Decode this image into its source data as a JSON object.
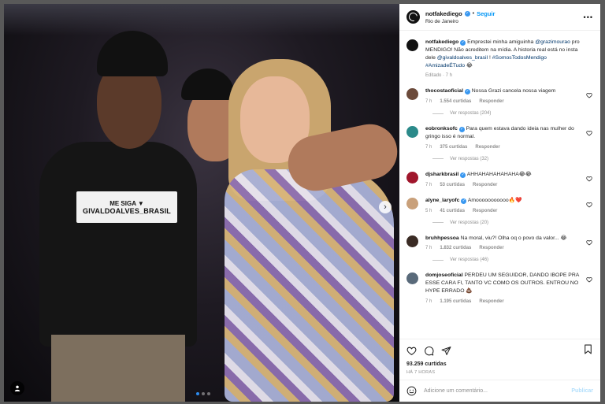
{
  "post": {
    "username": "notfakediego",
    "follow_label": "Seguir",
    "location": "Rio de Janeiro",
    "more_label": "•••"
  },
  "photo": {
    "shirt_line1": "ME SIGA ▼",
    "shirt_line2": "GIVALDOALVES_BRASIL",
    "next_arrow": "›"
  },
  "caption": {
    "username": "notfakediego",
    "text_a": "Emprestei minha amiguinha ",
    "mention1": "@grazimourao",
    "text_b": " pro MENDIGO! Não acreditem na mídia. A historia real está no insta dele ",
    "mention2": "@givaldoalves_brasil",
    "text_c": " ! ",
    "tags": "#SomosTodosMendigo #AmizadeÉTudo",
    "emoji": "😂",
    "edited": "Editado · 7 h"
  },
  "comments": [
    {
      "user": "thocostaoficial",
      "verified": true,
      "text": "Nossa Grazi cancela nossa viagem",
      "time": "7 h",
      "likes": "1.554 curtidas",
      "reply": "Responder",
      "replies": "Ver respostas (204)",
      "avatar_color": "#6b4a3a"
    },
    {
      "user": "eobronksofc",
      "verified": true,
      "text": "Para quem estava dando ideia nas mulher do gringo isso é normal.",
      "time": "7 h",
      "likes": "375 curtidas",
      "reply": "Responder",
      "replies": "Ver respostas (32)",
      "avatar_color": "#2b8a8a"
    },
    {
      "user": "djsharkbrasil",
      "verified": true,
      "text": "AHHAHAHAHAHAHA😂😂",
      "time": "7 h",
      "likes": "53 curtidas",
      "reply": "Responder",
      "replies": "",
      "avatar_color": "#a0162c"
    },
    {
      "user": "alyne_laryofc",
      "verified": true,
      "text": "Amooooooooooo🔥❤️",
      "time": "5 h",
      "likes": "41 curtidas",
      "reply": "Responder",
      "replies": "Ver respostas (20)",
      "avatar_color": "#c9a07a"
    },
    {
      "user": "bruhhpessoa",
      "verified": false,
      "text": "Na moral, viu?! Olha oq o povo da valor... 😂",
      "time": "7 h",
      "likes": "1.832 curtidas",
      "reply": "Responder",
      "replies": "Ver respostas (46)",
      "avatar_color": "#3a2b24"
    },
    {
      "user": "domjoseoficial",
      "verified": false,
      "text": "PERDEU UM SEGUIDOR, DANDO IBOPE PRA ESSE CARA FI, TANTO VC COMO OS OUTROS. ENTROU NO HYPE ERRADO 💩",
      "time": "7 h",
      "likes": "1.195 curtidas",
      "reply": "Responder",
      "replies": "",
      "avatar_color": "#596a7a"
    }
  ],
  "footer": {
    "likes": "93.259 curtidas",
    "time": "HÁ 7 HORAS",
    "comment_placeholder": "Adicione um comentário...",
    "publish": "Publicar"
  },
  "colors": {
    "accent": "#0095f6",
    "verified": "#3897f0"
  }
}
